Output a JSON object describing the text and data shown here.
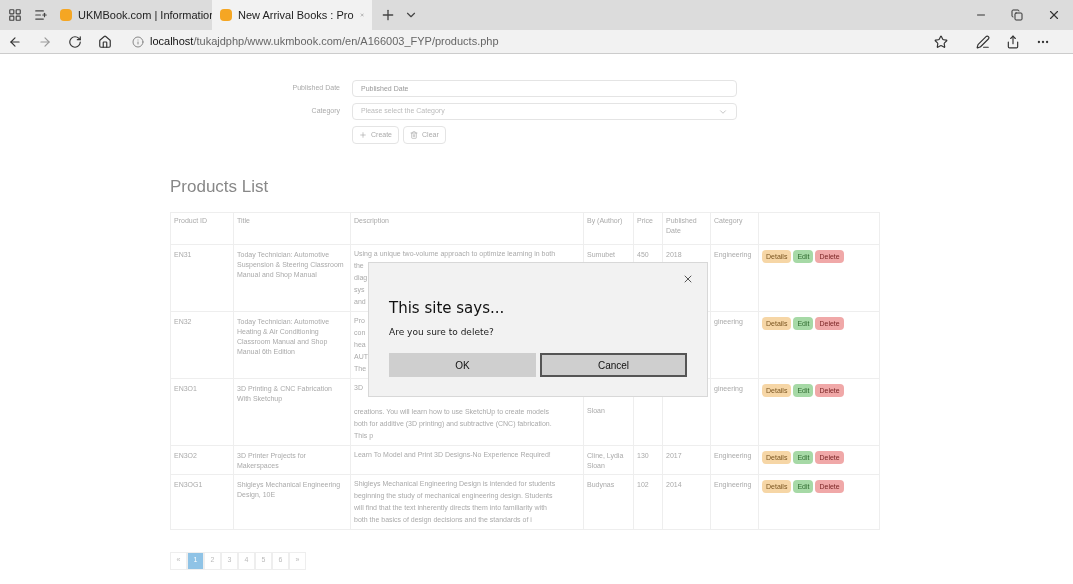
{
  "browser": {
    "tabs": [
      {
        "title": "UKMBook.com | Informatior",
        "selected": false
      },
      {
        "title": "New Arrival Books : Pro",
        "selected": true
      }
    ],
    "address": {
      "host": "localhost",
      "path": "/tukajdphp/www.ukmbook.com/en/A166003_FYP/products.php"
    }
  },
  "form": {
    "fields": [
      {
        "kind": "input",
        "label": "Published Date",
        "placeholder": "Published Date"
      },
      {
        "kind": "select",
        "label": "Category",
        "placeholder": "Please select the Category"
      }
    ],
    "buttons": [
      {
        "kind": "create",
        "label": "Create"
      },
      {
        "kind": "clear",
        "label": "Clear"
      }
    ]
  },
  "heading": "Products List",
  "table": {
    "columns": [
      "Product ID",
      "Title",
      "Description",
      "By (Author)",
      "Price",
      "Published Date",
      "Category"
    ],
    "rows": [
      {
        "id": "EN31",
        "title": "Today Technician: Automotive Suspension & Steering Classroom Manual and Shop Manual",
        "description": [
          "Using a unique two-volume approach to optimize learning in both",
          "the",
          "diag",
          "sys",
          "and"
        ],
        "by": "Sumubet",
        "price": "450",
        "published": "2018",
        "category": "Engineering",
        "actions": [
          "Details",
          "Edit",
          "Delete"
        ]
      },
      {
        "id": "EN32",
        "title": "Today Technician: Automotive Heating & Air Conditioning Classroom Manual and Shop Manual 6th Edition",
        "description": [
          "Pro",
          "con",
          "hea",
          "AUT",
          "The"
        ],
        "category": "gineering",
        "actions": [
          "Details",
          "Edit",
          "Delete"
        ]
      },
      {
        "id": "EN3O1",
        "kind": "covered",
        "title": "3D Printing & CNC Fabrication With Sketchup",
        "description": [
          "3D"
        ],
        "description_below": [
          "creations. You will learn how to use SketchUp to create models",
          "both for additive (3D printing) and subtractive (CNC) fabrication.",
          "This p"
        ],
        "by": "Sloan",
        "category": "gineering",
        "actions": [
          "Details",
          "Edit",
          "Delete"
        ]
      },
      {
        "id": "EN3O2",
        "title": "3D Printer Projects for Makerspaces",
        "description": [
          "Learn To Model and Print 3D Designs-No Experience Required!"
        ],
        "by": "Cline, Lydia Sloan",
        "price": "130",
        "published": "2017",
        "category": "Engineering",
        "actions": [
          "Details",
          "Edit",
          "Delete"
        ]
      },
      {
        "id": "EN3OG1",
        "title": "Shigleys Mechanical Engineering Design, 10E",
        "description": [
          "Shigleys Mechanical Engineering Design is intended for students",
          "beginning the study of mechanical engineering design. Students",
          "will find that the text inherently directs them into familiarity with",
          "both the basics of design decisions and the standards of i"
        ],
        "by": "Budynas",
        "price": "102",
        "published": "2014",
        "category": "Engineering",
        "actions": [
          "Details",
          "Edit",
          "Delete"
        ]
      }
    ]
  },
  "pagination": [
    {
      "label": "«",
      "selected": false
    },
    {
      "label": "1",
      "selected": true
    },
    {
      "label": "2",
      "selected": false
    },
    {
      "label": "3",
      "selected": false
    },
    {
      "label": "4",
      "selected": false
    },
    {
      "label": "5",
      "selected": false
    },
    {
      "label": "6",
      "selected": false
    },
    {
      "label": "»",
      "selected": false
    }
  ],
  "dialog": {
    "title": "This site says...",
    "message": "Are you sure to delete?",
    "buttons": [
      {
        "label": "OK",
        "selected": false
      },
      {
        "label": "Cancel",
        "selected": true
      }
    ]
  }
}
